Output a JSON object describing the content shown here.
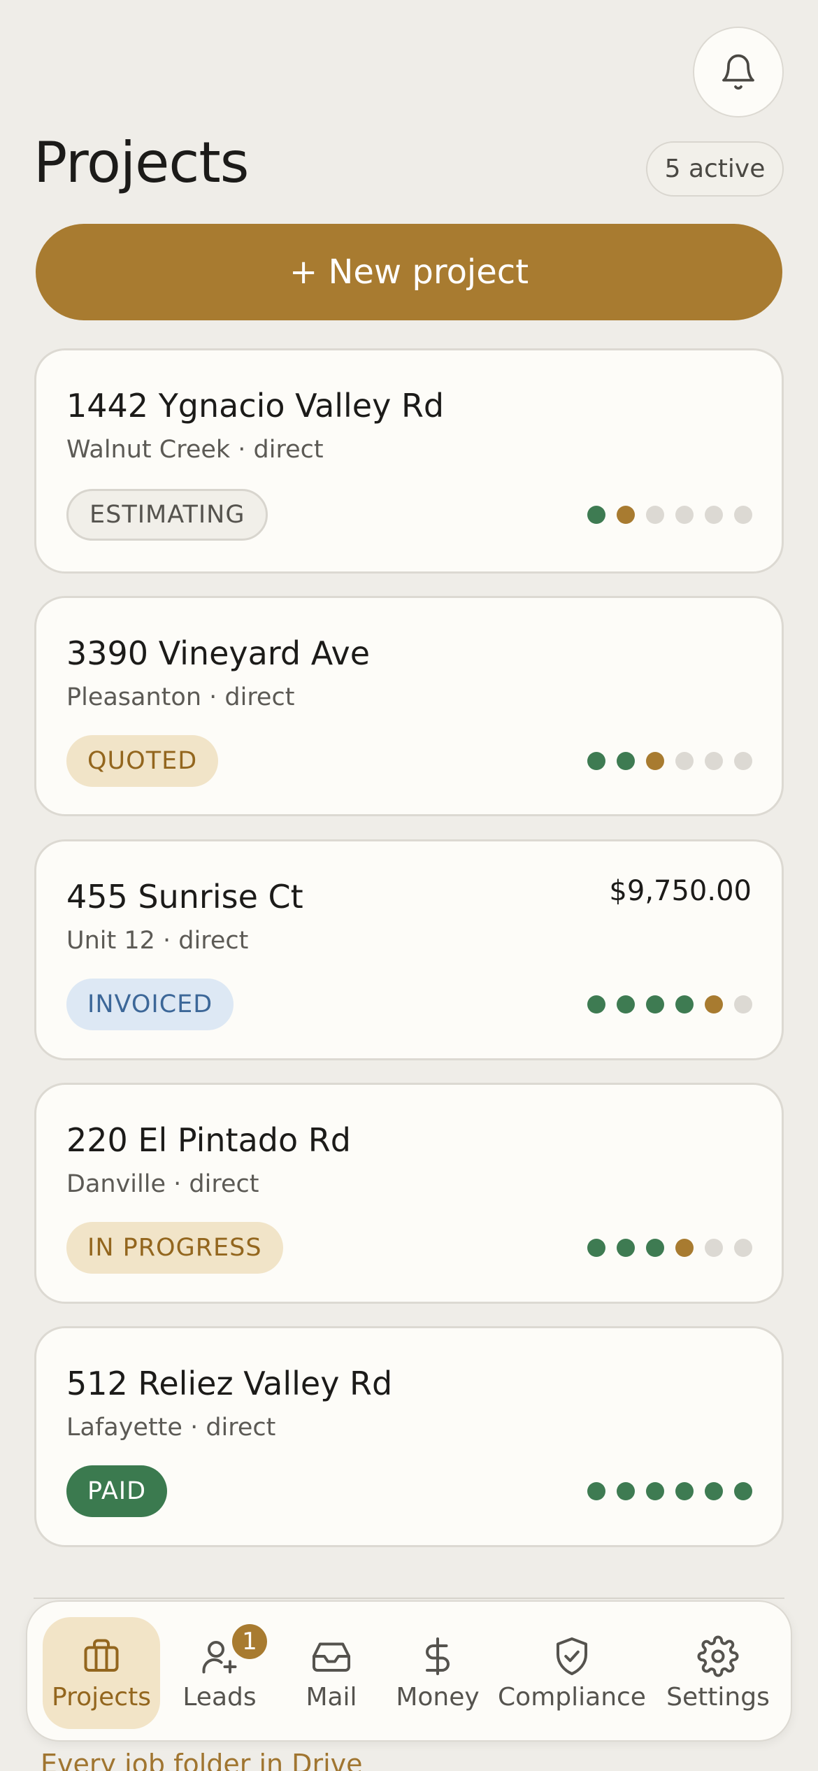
{
  "header": {
    "title": "Projects",
    "active_count": "5 active",
    "notifications_icon": "bell-icon"
  },
  "actions": {
    "new_project_label": "+ New project"
  },
  "projects": [
    {
      "address": "1442 Ygnacio Valley Rd",
      "subtitle": "Walnut Creek · direct",
      "status": "ESTIMATING",
      "amount": "",
      "stages": [
        "done",
        "current",
        "todo",
        "todo",
        "todo",
        "todo"
      ]
    },
    {
      "address": "3390 Vineyard Ave",
      "subtitle": "Pleasanton · direct",
      "status": "QUOTED",
      "amount": "",
      "stages": [
        "done",
        "done",
        "current",
        "todo",
        "todo",
        "todo"
      ]
    },
    {
      "address": "455 Sunrise Ct",
      "subtitle": "Unit 12 · direct",
      "status": "INVOICED",
      "amount": "$9,750.00",
      "stages": [
        "done",
        "done",
        "done",
        "done",
        "current",
        "todo"
      ]
    },
    {
      "address": "220 El Pintado Rd",
      "subtitle": "Danville · direct",
      "status": "IN PROGRESS",
      "amount": "",
      "stages": [
        "done",
        "done",
        "done",
        "current",
        "todo",
        "todo"
      ]
    },
    {
      "address": "512 Reliez Valley Rd",
      "subtitle": "Lafayette · direct",
      "status": "PAID",
      "amount": "",
      "stages": [
        "done",
        "done",
        "done",
        "done",
        "done",
        "done"
      ]
    }
  ],
  "tabbar": {
    "items": [
      {
        "label": "Projects",
        "icon": "briefcase-icon",
        "active": true
      },
      {
        "label": "Leads",
        "icon": "user-plus-icon",
        "badge": "1"
      },
      {
        "label": "Mail",
        "icon": "inbox-icon"
      },
      {
        "label": "Money",
        "icon": "dollar-icon"
      },
      {
        "label": "Compliance",
        "icon": "shield-check-icon"
      },
      {
        "label": "Settings",
        "icon": "gear-icon"
      }
    ]
  },
  "footer_note": "Every job folder in Drive",
  "colors": {
    "background": "#efede8",
    "card": "#fdfcf8",
    "accent": "#a87b30",
    "done": "#3e7b52",
    "todo": "#dcd9d3",
    "invoiced": "#3c6798"
  }
}
